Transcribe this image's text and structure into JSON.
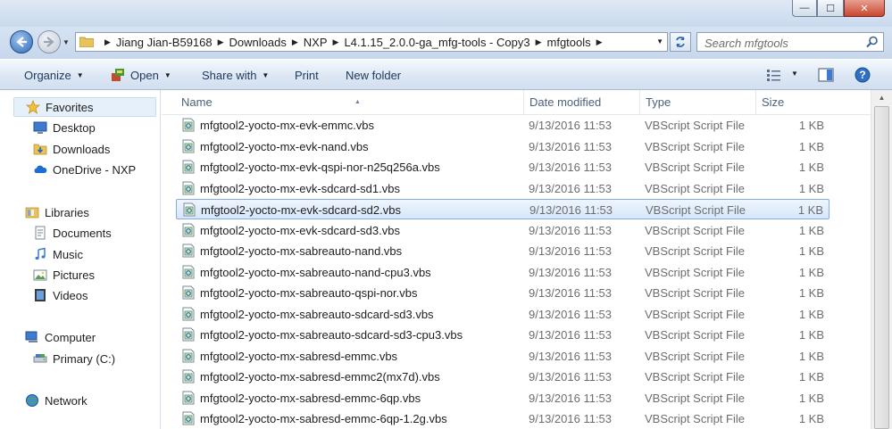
{
  "window": {
    "minimize": "—",
    "maximize": "☐",
    "close": "✕"
  },
  "address": {
    "crumbs": [
      "Jiang Jian-B59168",
      "Downloads",
      "NXP",
      "L4.1.15_2.0.0-ga_mfg-tools - Copy3",
      "mfgtools"
    ]
  },
  "search": {
    "placeholder": "Search mfgtools"
  },
  "commands": {
    "organize": "Organize",
    "open": "Open",
    "share_with": "Share with",
    "print": "Print",
    "new_folder": "New folder"
  },
  "nav_pane": {
    "favorites": "Favorites",
    "desktop": "Desktop",
    "downloads": "Downloads",
    "onedrive": "OneDrive - NXP",
    "libraries": "Libraries",
    "documents": "Documents",
    "music": "Music",
    "pictures": "Pictures",
    "videos": "Videos",
    "computer": "Computer",
    "primary": "Primary (C:)",
    "network": "Network"
  },
  "columns": {
    "name": "Name",
    "date": "Date modified",
    "type": "Type",
    "size": "Size"
  },
  "files": [
    {
      "name": "mfgtool2-yocto-mx-evk-emmc.vbs",
      "date": "9/13/2016 11:53",
      "type": "VBScript Script File",
      "size": "1 KB"
    },
    {
      "name": "mfgtool2-yocto-mx-evk-nand.vbs",
      "date": "9/13/2016 11:53",
      "type": "VBScript Script File",
      "size": "1 KB"
    },
    {
      "name": "mfgtool2-yocto-mx-evk-qspi-nor-n25q256a.vbs",
      "date": "9/13/2016 11:53",
      "type": "VBScript Script File",
      "size": "1 KB"
    },
    {
      "name": "mfgtool2-yocto-mx-evk-sdcard-sd1.vbs",
      "date": "9/13/2016 11:53",
      "type": "VBScript Script File",
      "size": "1 KB"
    },
    {
      "name": "mfgtool2-yocto-mx-evk-sdcard-sd2.vbs",
      "date": "9/13/2016 11:53",
      "type": "VBScript Script File",
      "size": "1 KB"
    },
    {
      "name": "mfgtool2-yocto-mx-evk-sdcard-sd3.vbs",
      "date": "9/13/2016 11:53",
      "type": "VBScript Script File",
      "size": "1 KB"
    },
    {
      "name": "mfgtool2-yocto-mx-sabreauto-nand.vbs",
      "date": "9/13/2016 11:53",
      "type": "VBScript Script File",
      "size": "1 KB"
    },
    {
      "name": "mfgtool2-yocto-mx-sabreauto-nand-cpu3.vbs",
      "date": "9/13/2016 11:53",
      "type": "VBScript Script File",
      "size": "1 KB"
    },
    {
      "name": "mfgtool2-yocto-mx-sabreauto-qspi-nor.vbs",
      "date": "9/13/2016 11:53",
      "type": "VBScript Script File",
      "size": "1 KB"
    },
    {
      "name": "mfgtool2-yocto-mx-sabreauto-sdcard-sd3.vbs",
      "date": "9/13/2016 11:53",
      "type": "VBScript Script File",
      "size": "1 KB"
    },
    {
      "name": "mfgtool2-yocto-mx-sabreauto-sdcard-sd3-cpu3.vbs",
      "date": "9/13/2016 11:53",
      "type": "VBScript Script File",
      "size": "1 KB"
    },
    {
      "name": "mfgtool2-yocto-mx-sabresd-emmc.vbs",
      "date": "9/13/2016 11:53",
      "type": "VBScript Script File",
      "size": "1 KB"
    },
    {
      "name": "mfgtool2-yocto-mx-sabresd-emmc2(mx7d).vbs",
      "date": "9/13/2016 11:53",
      "type": "VBScript Script File",
      "size": "1 KB"
    },
    {
      "name": "mfgtool2-yocto-mx-sabresd-emmc-6qp.vbs",
      "date": "9/13/2016 11:53",
      "type": "VBScript Script File",
      "size": "1 KB"
    },
    {
      "name": "mfgtool2-yocto-mx-sabresd-emmc-6qp-1.2g.vbs",
      "date": "9/13/2016 11:53",
      "type": "VBScript Script File",
      "size": "1 KB"
    }
  ],
  "selected_file": "mfgtool2-yocto-mx-evk-sdcard-sd2.vbs",
  "colors": {
    "selection_border": "#84acdd",
    "selection_fill": "#d6e7fa",
    "header_text": "#4c607a",
    "meta_text": "#6d6d6d"
  }
}
